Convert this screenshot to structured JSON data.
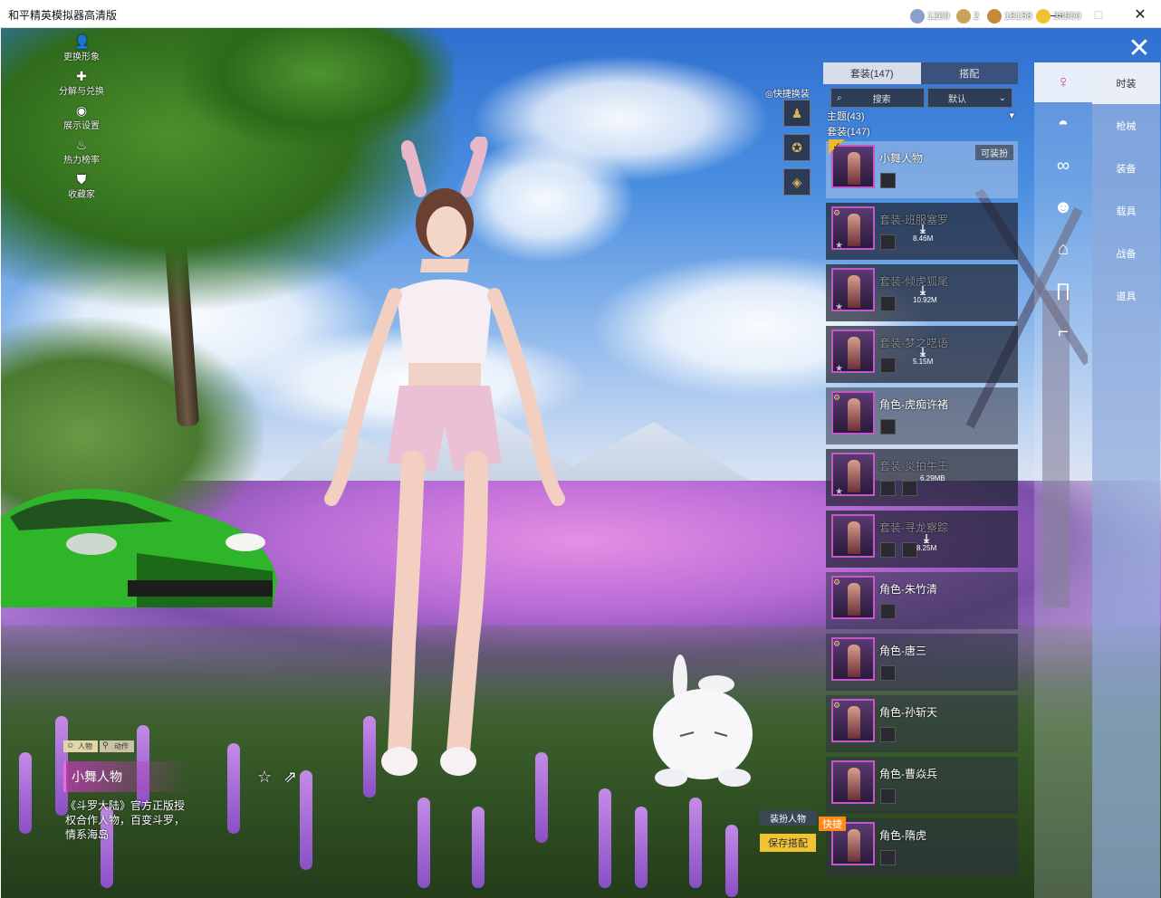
{
  "window": {
    "title": "和平精英模拟器高清版",
    "min": "—",
    "max": "□",
    "close": "✕"
  },
  "left_menu": [
    {
      "icon": "person-icon",
      "glyph": "👤",
      "label": "更换形象"
    },
    {
      "icon": "puzzle-icon",
      "glyph": "✚",
      "label": "分解与兑换"
    },
    {
      "icon": "eye-icon",
      "glyph": "◉",
      "label": "展示设置"
    },
    {
      "icon": "flame-icon",
      "glyph": "♨",
      "label": "热力榜率"
    },
    {
      "icon": "collection-icon",
      "glyph": "⛊",
      "label": "收藏家"
    }
  ],
  "currencies": [
    {
      "icon": "globe-coin-icon",
      "value": "1200",
      "color": "#8aa0c8"
    },
    {
      "icon": "c-coin-icon",
      "value": "2",
      "color": "#c8a35a"
    },
    {
      "icon": "bronze-coin-icon",
      "value": "18158",
      "color": "#c48a3a"
    },
    {
      "icon": "gold-coin-icon",
      "value": "38900",
      "color": "#f2c233"
    }
  ],
  "quick_switch": {
    "label": "◎快捷换装"
  },
  "panel": {
    "tabs": [
      {
        "label": "套装(147)",
        "active": true
      },
      {
        "label": "搭配",
        "active": false
      }
    ],
    "search_label": "搜索",
    "sort_label": "默认",
    "categories": [
      {
        "label": "主题(43)",
        "arrow": "▾"
      },
      {
        "label": "套装(147)"
      }
    ],
    "badge": "可装扮",
    "items": [
      {
        "name": "小舞人物",
        "state": "selected"
      },
      {
        "name": "套装-班服塞罗",
        "state": "dim",
        "size": "8.46M"
      },
      {
        "name": "套装-倾虎狐尾",
        "state": "dim",
        "size": "10.92M"
      },
      {
        "name": "套装-梦之呓语",
        "state": "dim",
        "size": "5.15M"
      },
      {
        "name": "角色-虎痴许褚",
        "state": "normal"
      },
      {
        "name": "套装-炎拍牛王",
        "state": "dim",
        "size": "6.29MB"
      },
      {
        "name": "套装-寻龙察踪",
        "state": "dim",
        "size": "8.25M"
      },
      {
        "name": "角色-朱竹清",
        "state": "normal"
      },
      {
        "name": "角色-唐三",
        "state": "normal"
      },
      {
        "name": "角色-孙斩天",
        "state": "normal"
      },
      {
        "name": "角色-曹焱兵",
        "state": "normal"
      },
      {
        "name": "角色-隋虎",
        "state": "normal",
        "tag": "快捷"
      }
    ]
  },
  "category_tabs": [
    {
      "icon": "bunny-hair-icon",
      "label": "时装",
      "active": true
    },
    {
      "icon": "cap-icon",
      "label": "枪械",
      "active": false
    },
    {
      "icon": "goggles-icon",
      "label": "装备",
      "active": false
    },
    {
      "icon": "mask-icon",
      "label": "载具",
      "active": false
    },
    {
      "icon": "jacket-icon",
      "label": "战备",
      "active": false
    },
    {
      "icon": "pants-icon",
      "label": "道具",
      "active": false
    },
    {
      "icon": "shoes-icon",
      "label": "",
      "active": false
    }
  ],
  "character": {
    "modes": [
      {
        "label": "人物"
      },
      {
        "label": "动作"
      }
    ],
    "name": "小舞人物",
    "description": "《斗罗大陆》官方正版授权合作人物，百变斗罗，情系海岛"
  },
  "buttons": {
    "dress": "装扮人物",
    "save": "保存搭配"
  }
}
